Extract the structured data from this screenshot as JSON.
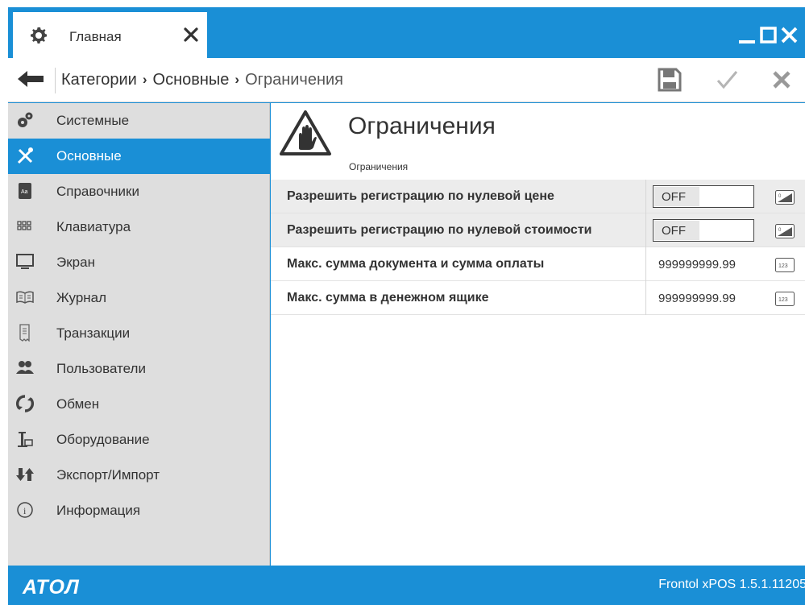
{
  "window": {
    "tab_label": "Главная"
  },
  "toolbar": {
    "breadcrumbs": [
      "Категории",
      "Основные",
      "Ограничения"
    ]
  },
  "sidebar": {
    "items": [
      {
        "label": "Системные",
        "icon": "gears-icon"
      },
      {
        "label": "Основные",
        "icon": "tools-icon",
        "active": true
      },
      {
        "label": "Справочники",
        "icon": "book-icon"
      },
      {
        "label": "Клавиатура",
        "icon": "keyboard-icon"
      },
      {
        "label": "Экран",
        "icon": "monitor-icon"
      },
      {
        "label": "Журнал",
        "icon": "journal-icon"
      },
      {
        "label": "Транзакции",
        "icon": "receipt-icon"
      },
      {
        "label": "Пользователи",
        "icon": "users-icon"
      },
      {
        "label": "Обмен",
        "icon": "sync-icon"
      },
      {
        "label": "Оборудование",
        "icon": "hardware-icon"
      },
      {
        "label": "Экспорт/Импорт",
        "icon": "export-import-icon"
      },
      {
        "label": "Информация",
        "icon": "info-icon"
      }
    ]
  },
  "main": {
    "title": "Ограничения",
    "subtitle": "Ограничения",
    "settings": [
      {
        "label": "Разрешить регистрацию по нулевой цене",
        "type": "toggle",
        "value": "OFF"
      },
      {
        "label": "Разрешить регистрацию по нулевой стоимости",
        "type": "toggle",
        "value": "OFF"
      },
      {
        "label": "Макс. сумма документа и сумма оплаты",
        "type": "number",
        "value": "999999999.99"
      },
      {
        "label": "Макс. сумма в денежном ящике",
        "type": "number",
        "value": "999999999.99"
      }
    ]
  },
  "status": {
    "logo": "АТОЛ",
    "version": "Frontol xPOS 1.5.1.11205"
  },
  "colors": {
    "accent": "#1a8fd6",
    "sidebar_bg": "#dedede",
    "row_shaded": "#ececec"
  }
}
